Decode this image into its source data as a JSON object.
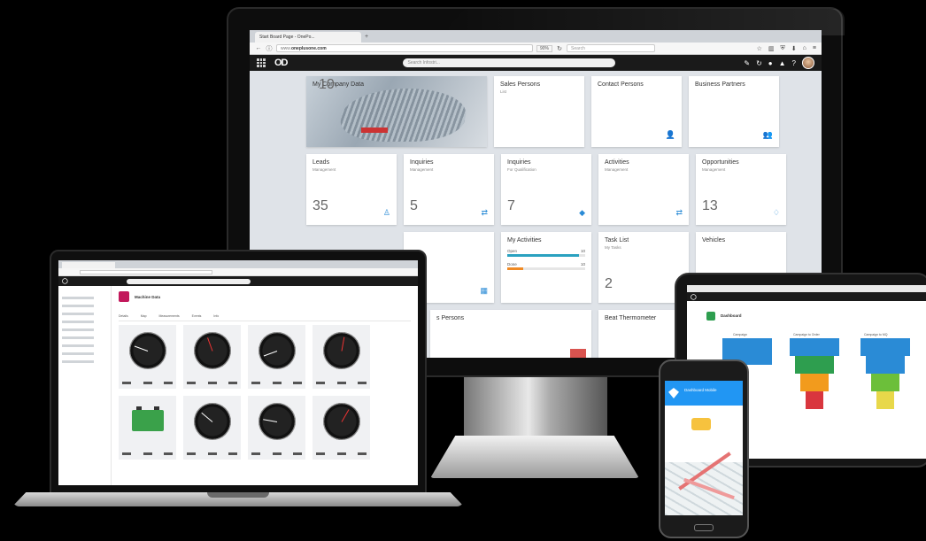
{
  "monitor": {
    "browser": {
      "tab_title": "Start Board Page - OnePo...",
      "url_host": "www.",
      "url_domain": "oneplusone.com",
      "zoom": "90%",
      "search_placeholder": "Search"
    },
    "app": {
      "logo": "OD",
      "search_placeholder": "Search Infostri..."
    },
    "tiles": {
      "my_company": {
        "title": "My Company Data",
        "value": "10"
      },
      "sales_persons": {
        "title": "Sales Persons",
        "sub": "List"
      },
      "contact_persons": {
        "title": "Contact Persons"
      },
      "business_partners": {
        "title": "Business Partners"
      },
      "leads": {
        "title": "Leads",
        "sub": "Management",
        "value": "35"
      },
      "inquiries1": {
        "title": "Inquiries",
        "sub": "Management",
        "value": "5"
      },
      "inquiries2": {
        "title": "Inquiries",
        "sub": "For Qualification",
        "value": "7"
      },
      "activities": {
        "title": "Activities",
        "sub": "Management"
      },
      "opportunities": {
        "title": "Opportunities",
        "sub": "Management",
        "value": "13"
      },
      "my_activities": {
        "title": "My Activities",
        "rows": [
          {
            "label": "Open",
            "value": "10"
          },
          {
            "label": "Done",
            "value": "10"
          }
        ]
      },
      "task_list": {
        "title": "Task List",
        "sub": "My Tasks",
        "value": "2"
      },
      "vehicles": {
        "title": "Vehicles"
      },
      "sales_persons_partial": {
        "title": "s Persons"
      },
      "beat_thermometer": {
        "title": "Beat Thermometer"
      }
    },
    "colors": {
      "accent": "#2a8bd6",
      "progress_open": "#2aa1c0",
      "progress_done": "#f08a24"
    },
    "icons": [
      "grid-icon",
      "pencil-icon",
      "refresh-icon",
      "user-icon",
      "bell-icon",
      "help-icon"
    ]
  },
  "laptop": {
    "title": "Machine Data",
    "tabs": [
      "Details",
      "Map",
      "Measurements",
      "Events",
      "Info"
    ]
  },
  "tablet": {
    "title": "Dashboard",
    "funnels": [
      "Campaign",
      "Campaign to Order",
      "Campaign to MQ"
    ]
  },
  "phone": {
    "title": "Dashboard Mobile"
  }
}
